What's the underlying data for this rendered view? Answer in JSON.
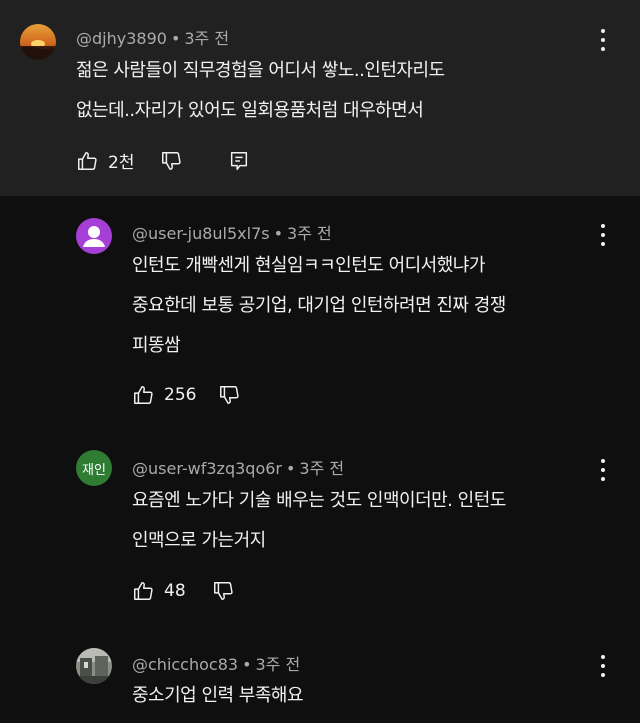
{
  "comments": [
    {
      "username": "@djhy3890",
      "time": "3주 전",
      "text_lines": [
        "젊은 사람들이 직무경험을 어디서 쌓노..인턴자리도",
        "없는데..자리가 있어도 일회용품처럼 대우하면서"
      ],
      "likes": "2천",
      "avatar": "sunset-avatar"
    },
    {
      "username": "@user-ju8ul5xl7s",
      "time": "3주 전",
      "text_lines": [
        "인턴도 개빡센게 현실임ㅋㅋ인턴도 어디서했냐가",
        "중요한데 보통 공기업, 대기업 인턴하려면 진짜 경쟁",
        "피똥쌈"
      ],
      "likes": "256",
      "avatar": "default-person-avatar",
      "avatar_color": "#a53fd6"
    },
    {
      "username": "@user-wf3zq3qo6r",
      "time": "3주 전",
      "text_lines": [
        "요즘엔 노가다 기술 배우는 것도 인맥이더만. 인턴도",
        "인맥으로 가는거지"
      ],
      "likes": "48",
      "avatar_text": "재인",
      "avatar_color": "#2e7d32"
    },
    {
      "username": "@chicchoc83",
      "time": "3주 전",
      "text_lines": [
        "중소기업 인력 부족해요"
      ],
      "avatar": "photo-avatar"
    }
  ],
  "dot_separator": "•",
  "colors": {
    "background": "#0f0f0f",
    "highlight_background": "#212121",
    "meta_text": "#aaaaaa",
    "primary_text": "#f1f1f1"
  }
}
